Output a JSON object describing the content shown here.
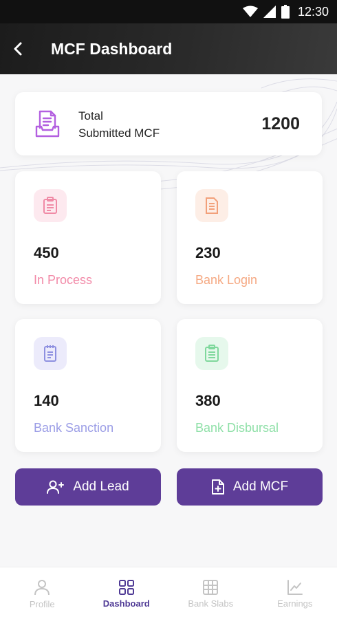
{
  "status_bar": {
    "time": "12:30"
  },
  "app_bar": {
    "title": "MCF Dashboard"
  },
  "total_card": {
    "label_line1": "Total",
    "label_line2": "Submitted MCF",
    "value": "1200"
  },
  "stats": [
    {
      "value": "450",
      "label": "In Process",
      "label_color": "#f28aa8",
      "icon_bg": "#fde9ef",
      "icon_color": "#f08aa6"
    },
    {
      "value": "230",
      "label": "Bank Login",
      "label_color": "#f5a983",
      "icon_bg": "#fdeee6",
      "icon_color": "#f2a07a"
    },
    {
      "value": "140",
      "label": "Bank Sanction",
      "label_color": "#9b9de6",
      "icon_bg": "#ecebfb",
      "icon_color": "#8e90e0"
    },
    {
      "value": "380",
      "label": "Bank Disbursal",
      "label_color": "#8fe0a8",
      "icon_bg": "#e6f8ec",
      "icon_color": "#7fd89c"
    }
  ],
  "actions": {
    "add_lead": "Add Lead",
    "add_mcf": "Add MCF"
  },
  "bottom_nav": {
    "profile": "Profile",
    "dashboard": "Dashboard",
    "bank_slabs": "Bank Slabs",
    "earnings": "Earnings"
  },
  "colors": {
    "primary": "#5e3d98",
    "active_nav": "#4f3a95",
    "total_icon": "#b35fe0"
  }
}
